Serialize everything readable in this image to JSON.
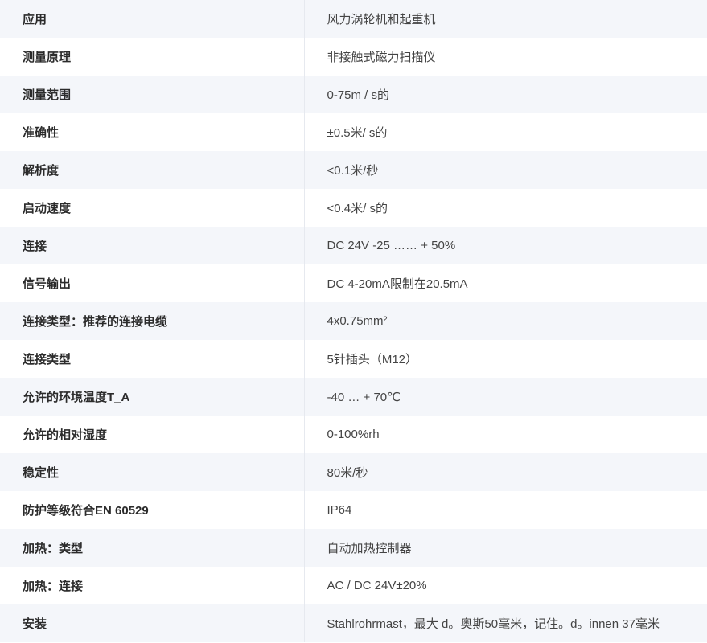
{
  "specs": [
    {
      "label": "应用",
      "value": "风力涡轮机和起重机"
    },
    {
      "label": "测量原理",
      "value": "非接触式磁力扫描仪"
    },
    {
      "label": "测量范围",
      "value": "0-75m / s的"
    },
    {
      "label": "准确性",
      "value": "±0.5米/ s的"
    },
    {
      "label": "解析度",
      "value": "<0.1米/秒"
    },
    {
      "label": "启动速度",
      "value": "<0.4米/ s的"
    },
    {
      "label": "连接",
      "value": "DC 24V -25 …… + 50%"
    },
    {
      "label": "信号输出",
      "value": "DC 4-20mA限制在20.5mA"
    },
    {
      "label": "连接类型：推荐的连接电缆",
      "value": "4x0.75mm²"
    },
    {
      "label": "连接类型",
      "value": "5针插头（M12）"
    },
    {
      "label": "允许的环境温度T_A",
      "value": "-40 … + 70℃"
    },
    {
      "label": "允许的相对湿度",
      "value": "0-100%rh"
    },
    {
      "label": "稳定性",
      "value": "80米/秒"
    },
    {
      "label": "防护等级符合EN 60529",
      "value": "IP64"
    },
    {
      "label": "加热：类型",
      "value": "自动加热控制器"
    },
    {
      "label": "加热：连接",
      "value": "AC / DC 24V±20%"
    },
    {
      "label": "安装",
      "value": "Stahlrohrmast，最大 d。奥斯50毫米，记住。d。innen 37毫米"
    }
  ]
}
